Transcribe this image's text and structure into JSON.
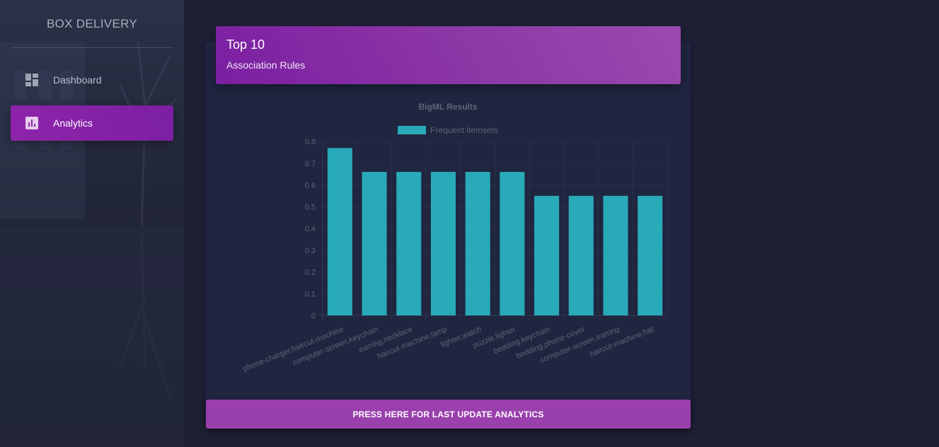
{
  "sidebar": {
    "brand": "BOX DELIVERY",
    "items": [
      {
        "label": "Dashboard",
        "icon": "dashboard-icon",
        "active": false
      },
      {
        "label": "Analytics",
        "icon": "analytics-icon",
        "active": true
      }
    ]
  },
  "card": {
    "title": "Top 10",
    "subtitle": "Association Rules",
    "button_label": "PRESS HERE FOR LAST UPDATE ANALYTICS"
  },
  "colors": {
    "accent": "#8e24aa",
    "bar": "#29aab8",
    "background": "#1e2135"
  },
  "chart_data": {
    "type": "bar",
    "title": "BigML Results",
    "xlabel": "",
    "ylabel": "",
    "legend_position": "top",
    "grid": true,
    "ylim": [
      0,
      0.8
    ],
    "yticks": [
      "0",
      "0.1",
      "0.2",
      "0.3",
      "0.4",
      "0.5",
      "0.6",
      "0.7",
      "0.8"
    ],
    "categories": [
      "phone-charger,haircut-machine",
      "computer-screen,keychain",
      "earring,necklace",
      "haircut-machine,lamp",
      "lighter,watch",
      "puzzle,lighter",
      "bedding,keychain",
      "bedding,phone-cover",
      "computer-screen,earring",
      "haircut-machine,hat"
    ],
    "series": [
      {
        "name": "Frequent itemsets",
        "values": [
          0.77,
          0.66,
          0.66,
          0.66,
          0.66,
          0.66,
          0.55,
          0.55,
          0.55,
          0.55
        ]
      }
    ]
  }
}
